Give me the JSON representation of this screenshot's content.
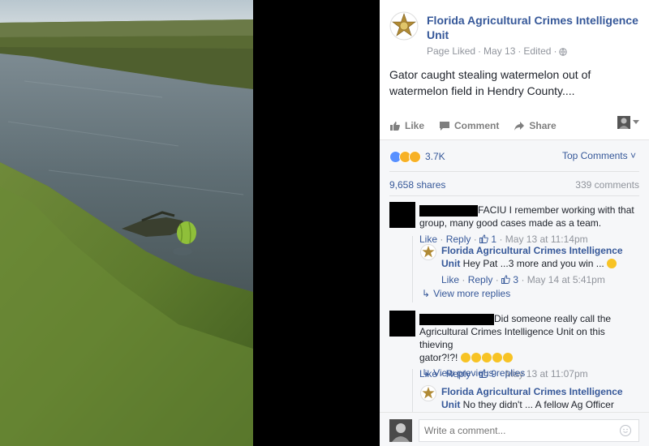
{
  "post": {
    "page_name": "Florida Agricultural Crimes Intelligence Unit",
    "meta_liked": "Page Liked",
    "meta_date": "May 13",
    "meta_edited": "Edited",
    "meta_sep": "·",
    "text": "Gator caught stealing watermelon out of watermelon field in Hendry County....",
    "avatar_icon": "sheriff-star-icon"
  },
  "actions": {
    "like": "Like",
    "comment": "Comment",
    "share": "Share"
  },
  "reactions": {
    "count": "3.7K",
    "sort_label": "Top Comments",
    "icons": [
      "like-reaction-icon",
      "haha-reaction-icon",
      "wow-reaction-icon"
    ],
    "colors": {
      "like": "#5890ff",
      "haha": "#f7b125"
    }
  },
  "stats": {
    "shares": "9,658 shares",
    "comments": "339 comments"
  },
  "comments": [
    {
      "text_line1": "FACIU I remember working with that",
      "text_line2": "group, many good cases made as a team.",
      "like": "Like",
      "reply": "Reply",
      "likes": "1",
      "time": "May 13 at 11:14pm",
      "reply_item": {
        "name": "Florida Agricultural Crimes Intelligence",
        "name2": "Unit",
        "text": "Hey Pat ...3 more and you win ...",
        "like": "Like",
        "reply": "Reply",
        "likes": "3",
        "time": "May 14 at 5:41pm"
      },
      "view_more": "View more replies"
    },
    {
      "text_line1": "Did someone really call the",
      "text_line2": "Agricultural Crimes Intelligence Unit on this thieving",
      "text_line3": "gator?!?!",
      "like": "Like",
      "reply": "Reply",
      "likes": "9",
      "time": "May 13 at 11:07pm",
      "view_previous": "View previous replies",
      "reply_item": {
        "name": "Florida Agricultural Crimes Intelligence",
        "name2": "Unit",
        "text": "No they didn't ... A fellow Ag Officer"
      }
    }
  ],
  "composer": {
    "placeholder": "Write a comment..."
  },
  "sep": "·"
}
